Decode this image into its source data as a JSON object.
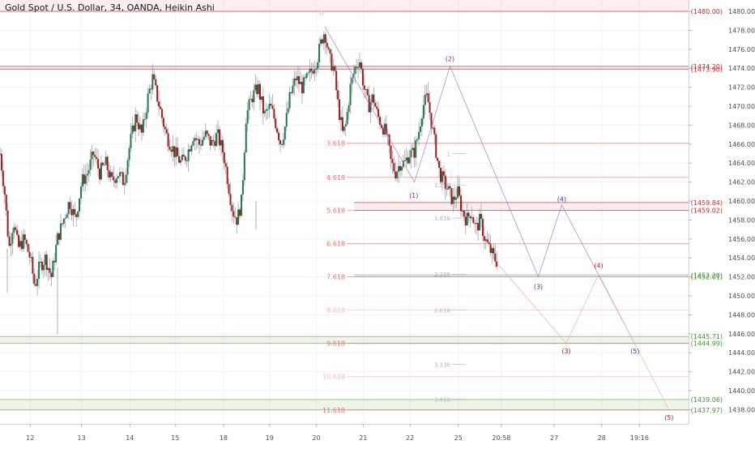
{
  "title": "Gold Spot / U.S. Dollar, 34, OANDA, Heikin Ashi",
  "colors": {
    "bg": "#ffffff",
    "grid": "#f0f3fa",
    "up": "#26744e",
    "down": "#9d1c1c",
    "wick": "#9598a1",
    "red_line": "#e06c6c",
    "green_line": "#8fc48f",
    "fib_red": "#e57373",
    "fib_green": "#7cb342",
    "fib_pink": "#f4b8b8",
    "fib_grey": "#b0b4bc",
    "purple": "#a06cc6",
    "wave_red": "#b22222",
    "wave_blue": "#3a3ab0",
    "wave_purple": "#8b2d7a",
    "axis_text": "#4a4e58",
    "label_red": "#c62828",
    "label_green": "#4a8f3a"
  },
  "chart_data": {
    "type": "candlestick",
    "ylim": [
      1436.5,
      1481.2
    ],
    "y_ticks": [
      1438,
      1440,
      1442,
      1444,
      1446,
      1448,
      1450,
      1452,
      1454,
      1456,
      1458,
      1460,
      1462,
      1464,
      1466,
      1468,
      1470,
      1472,
      1474,
      1476,
      1478,
      1480
    ],
    "x_ticks": [
      {
        "label": "12",
        "pos": 0.04
      },
      {
        "label": "13",
        "pos": 0.108
      },
      {
        "label": "14",
        "pos": 0.172
      },
      {
        "label": "15",
        "pos": 0.232
      },
      {
        "label": "18",
        "pos": 0.296
      },
      {
        "label": "19",
        "pos": 0.357
      },
      {
        "label": "20",
        "pos": 0.419
      },
      {
        "label": "21",
        "pos": 0.481
      },
      {
        "label": "22",
        "pos": 0.543
      },
      {
        "label": "25",
        "pos": 0.607
      },
      {
        "label": "20:58",
        "pos": 0.664
      },
      {
        "label": "27",
        "pos": 0.734
      },
      {
        "label": "28",
        "pos": 0.797
      },
      {
        "label": "19:16",
        "pos": 0.847
      }
    ],
    "price_path": [
      [
        0,
        1465
      ],
      [
        0.006,
        1461
      ],
      [
        0.012,
        1455
      ],
      [
        0.018,
        1458
      ],
      [
        0.024,
        1455
      ],
      [
        0.032,
        1456
      ],
      [
        0.04,
        1454
      ],
      [
        0.046,
        1451
      ],
      [
        0.052,
        1453
      ],
      [
        0.06,
        1454
      ],
      [
        0.068,
        1452
      ],
      [
        0.076,
        1456
      ],
      [
        0.084,
        1458
      ],
      [
        0.092,
        1460
      ],
      [
        0.1,
        1458
      ],
      [
        0.108,
        1462
      ],
      [
        0.116,
        1463
      ],
      [
        0.124,
        1465
      ],
      [
        0.132,
        1463
      ],
      [
        0.14,
        1464
      ],
      [
        0.148,
        1462
      ],
      [
        0.156,
        1463
      ],
      [
        0.164,
        1462
      ],
      [
        0.172,
        1466
      ],
      [
        0.18,
        1469
      ],
      [
        0.188,
        1467
      ],
      [
        0.196,
        1471
      ],
      [
        0.202,
        1473
      ],
      [
        0.208,
        1471
      ],
      [
        0.214,
        1469
      ],
      [
        0.22,
        1467
      ],
      [
        0.226,
        1466
      ],
      [
        0.232,
        1465
      ],
      [
        0.24,
        1464
      ],
      [
        0.248,
        1465
      ],
      [
        0.256,
        1467
      ],
      [
        0.264,
        1466
      ],
      [
        0.272,
        1467
      ],
      [
        0.28,
        1466
      ],
      [
        0.288,
        1467
      ],
      [
        0.296,
        1465
      ],
      [
        0.302,
        1462
      ],
      [
        0.308,
        1459
      ],
      [
        0.314,
        1458
      ],
      [
        0.32,
        1460
      ],
      [
        0.326,
        1469
      ],
      [
        0.334,
        1471
      ],
      [
        0.342,
        1472
      ],
      [
        0.35,
        1469
      ],
      [
        0.358,
        1470
      ],
      [
        0.366,
        1468
      ],
      [
        0.372,
        1466
      ],
      [
        0.378,
        1468
      ],
      [
        0.384,
        1471
      ],
      [
        0.392,
        1473
      ],
      [
        0.4,
        1472
      ],
      [
        0.408,
        1473
      ],
      [
        0.414,
        1474
      ],
      [
        0.42,
        1475
      ],
      [
        0.426,
        1477
      ],
      [
        0.43,
        1478
      ],
      [
        0.436,
        1475
      ],
      [
        0.442,
        1474
      ],
      [
        0.448,
        1470
      ],
      [
        0.454,
        1467
      ],
      [
        0.458,
        1468
      ],
      [
        0.464,
        1472
      ],
      [
        0.47,
        1474
      ],
      [
        0.476,
        1475
      ],
      [
        0.482,
        1472
      ],
      [
        0.488,
        1470
      ],
      [
        0.494,
        1471
      ],
      [
        0.5,
        1469
      ],
      [
        0.506,
        1468
      ],
      [
        0.512,
        1467
      ],
      [
        0.518,
        1464
      ],
      [
        0.524,
        1463
      ],
      [
        0.53,
        1464
      ],
      [
        0.536,
        1464
      ],
      [
        0.542,
        1465
      ],
      [
        0.548,
        1465
      ],
      [
        0.554,
        1467
      ],
      [
        0.56,
        1470
      ],
      [
        0.566,
        1471
      ],
      [
        0.57,
        1469
      ],
      [
        0.576,
        1466
      ],
      [
        0.582,
        1463
      ],
      [
        0.588,
        1462
      ],
      [
        0.594,
        1461
      ],
      [
        0.6,
        1460
      ],
      [
        0.606,
        1461
      ],
      [
        0.612,
        1459
      ],
      [
        0.618,
        1458
      ],
      [
        0.624,
        1459
      ],
      [
        0.63,
        1457
      ],
      [
        0.636,
        1458
      ],
      [
        0.642,
        1456
      ],
      [
        0.648,
        1455
      ],
      [
        0.654,
        1454
      ],
      [
        0.66,
        1453.5
      ]
    ],
    "levels": [
      {
        "price": 1480.0,
        "label": "(1480.00)",
        "color": "red",
        "band_to": 1481.2,
        "start": 0.0
      },
      {
        "price": 1474.2,
        "label": "(1474.20)",
        "color": "red",
        "band_to": 1473.9,
        "start": 0.0
      },
      {
        "price": 1473.9,
        "label": "(1473.90)",
        "color": "red",
        "start": 0.0
      },
      {
        "price": 1459.84,
        "label": "(1459.84)",
        "color": "red",
        "band_to": 1459.02,
        "start": 0.469
      },
      {
        "price": 1459.02,
        "label": "(1459.02)",
        "color": "red",
        "start": 0.469
      },
      {
        "price": 1452.2,
        "label": "(1452.20)",
        "color": "green",
        "start": 0.469
      },
      {
        "price": 1452.01,
        "label": "(1452.01)",
        "color": "green",
        "start": 0.469
      },
      {
        "price": 1445.71,
        "label": "(1445.71)",
        "color": "green",
        "band_to": 1444.99,
        "start": 0.0
      },
      {
        "price": 1444.99,
        "label": "(1444.99)",
        "color": "green",
        "start": 0.0
      },
      {
        "price": 1439.06,
        "label": "(1439.06)",
        "color": "green",
        "band_to": 1437.97,
        "start": 0.0
      },
      {
        "price": 1437.97,
        "label": "(1437.97)",
        "color": "green",
        "start": 0.0
      }
    ],
    "fib_labels": [
      {
        "text": "3.618",
        "price": 1466.1,
        "style": "red"
      },
      {
        "text": "4.618",
        "price": 1462.5,
        "style": "red"
      },
      {
        "text": "5.618",
        "price": 1459.0,
        "style": "red"
      },
      {
        "text": "6.618",
        "price": 1455.5,
        "style": "red"
      },
      {
        "text": "7.618",
        "price": 1452.0,
        "style": "red"
      },
      {
        "text": "8.618",
        "price": 1448.5,
        "style": "pink"
      },
      {
        "text": "9.618",
        "price": 1444.99,
        "style": "red"
      },
      {
        "text": "10.618",
        "price": 1441.5,
        "style": "pink"
      },
      {
        "text": "11.618",
        "price": 1437.97,
        "style": "red"
      }
    ],
    "fib2_labels": [
      {
        "text": "1",
        "price": 1465.0
      },
      {
        "text": "1.236",
        "price": 1461.7
      },
      {
        "text": "1.618",
        "price": 1458.2
      },
      {
        "text": "2.236",
        "price": 1452.3
      },
      {
        "text": "2.618",
        "price": 1448.5
      },
      {
        "text": "3.236",
        "price": 1442.8
      },
      {
        "text": "3.618",
        "price": 1439.1
      }
    ],
    "wave_labels": [
      {
        "text": "0",
        "x": 0.426,
        "price": 1479.8,
        "style": "pink"
      },
      {
        "text": "(1)",
        "x": 0.548,
        "price": 1460.6,
        "style": "purple"
      },
      {
        "text": "(2)",
        "x": 0.596,
        "price": 1475.0,
        "style": "purple"
      },
      {
        "text": "(3)",
        "x": 0.713,
        "price": 1451.0,
        "style": "blue"
      },
      {
        "text": "(4)",
        "x": 0.744,
        "price": 1460.2,
        "style": "blue"
      },
      {
        "text": "(3)",
        "x": 0.75,
        "price": 1444.2,
        "style": "red"
      },
      {
        "text": "(4)",
        "x": 0.793,
        "price": 1453.2,
        "style": "red"
      },
      {
        "text": "(5)",
        "x": 0.841,
        "price": 1444.2,
        "style": "blue"
      },
      {
        "text": "(5)",
        "x": 0.886,
        "price": 1437.2,
        "style": "red"
      }
    ]
  }
}
